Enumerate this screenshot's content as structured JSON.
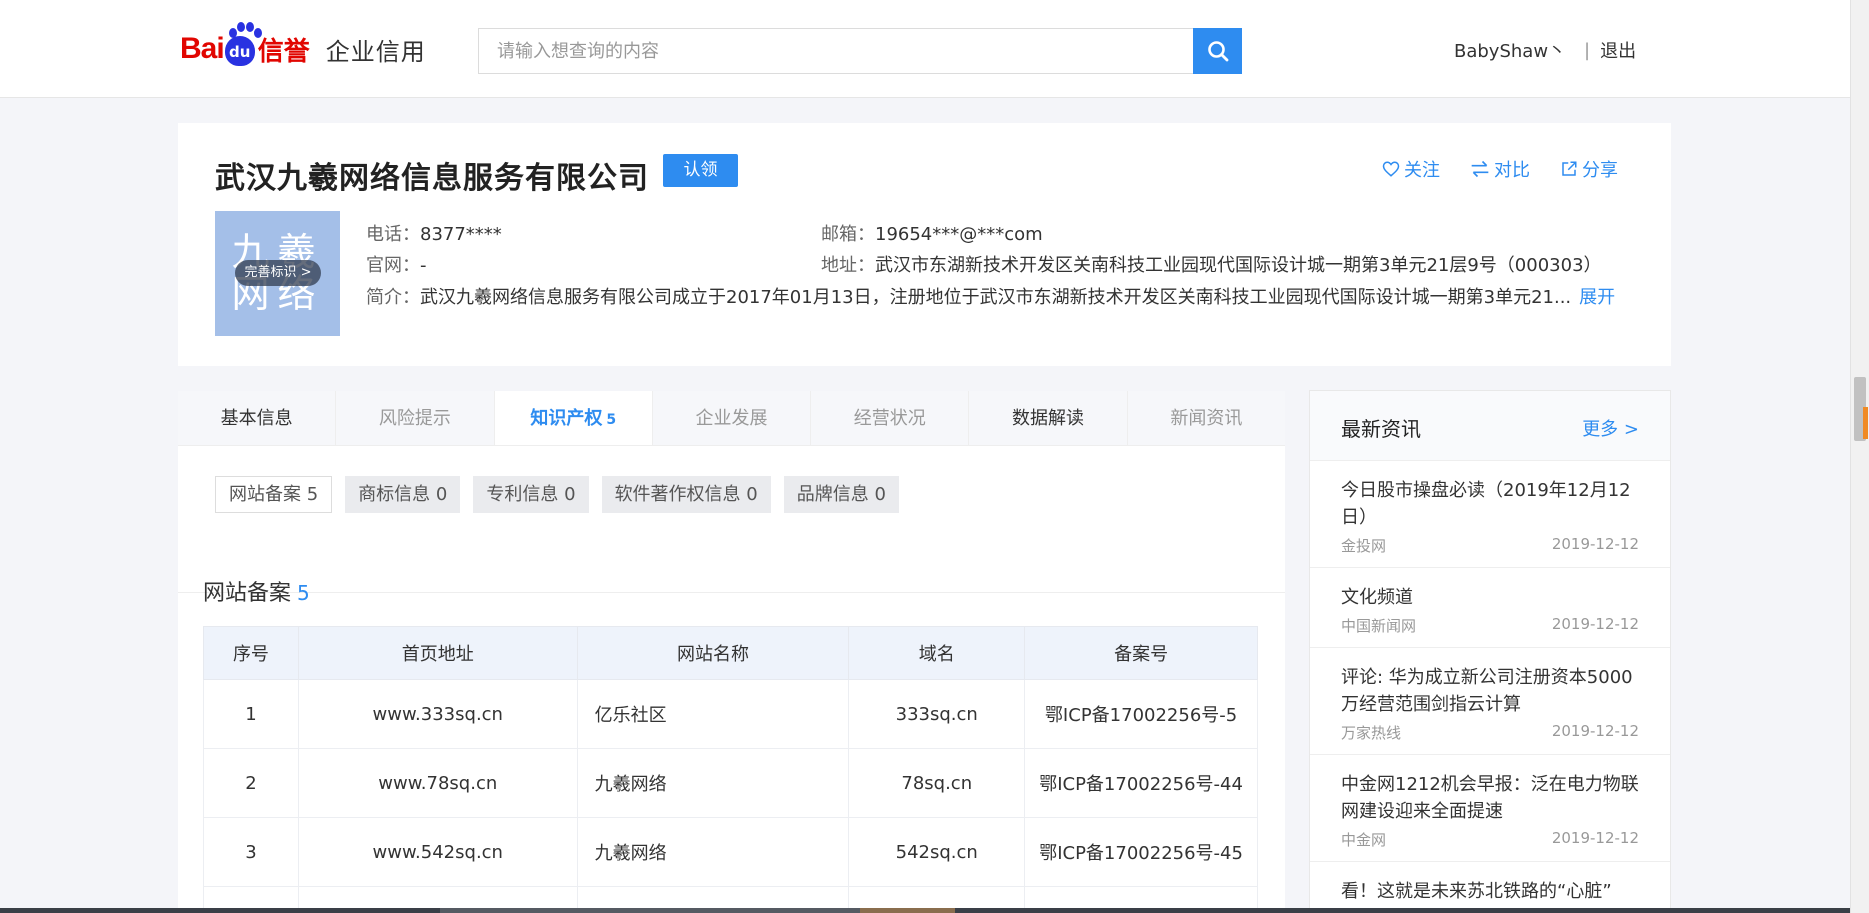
{
  "header": {
    "logo": {
      "bai": "Bai",
      "du": "du",
      "xinyu": "信誉",
      "product": "企业信用"
    },
    "search_placeholder": "请输入想查询的内容",
    "username": "BabyShaw丶",
    "separator": "|",
    "logout": "退出"
  },
  "company": {
    "name": "武汉九羲网络信息服务有限公司",
    "claim_label": "认领",
    "actions": {
      "follow": "关注",
      "compare": "对比",
      "share": "分享"
    },
    "logo_text": "九羲网络",
    "logo_badge": "完善标识 >",
    "phone_label": "电话：",
    "phone": "8377****",
    "website_label": "官网：",
    "website": "-",
    "intro_label": "简介：",
    "intro": "武汉九羲网络信息服务有限公司成立于2017年01月13日，注册地位于武汉市东湖新技术开发区关南科技工业园现代国际设计城一期第3单元21...",
    "expand_label": "展开",
    "email_label": "邮箱：",
    "email": "19654***@***com",
    "address_label": "地址：",
    "address": "武汉市东湖新技术开发区关南科技工业园现代国际设计城一期第3单元21层9号（000303）"
  },
  "tabs": [
    {
      "label": "基本信息"
    },
    {
      "label": "风险提示"
    },
    {
      "label": "知识产权",
      "count": "5"
    },
    {
      "label": "企业发展"
    },
    {
      "label": "经营状况"
    },
    {
      "label": "数据解读"
    },
    {
      "label": "新闻资讯"
    }
  ],
  "subtabs": [
    "网站备案 5",
    "商标信息 0",
    "专利信息 0",
    "软件著作权信息 0",
    "品牌信息 0"
  ],
  "section": {
    "title": "网站备案",
    "count": "5"
  },
  "table": {
    "headers": [
      "序号",
      "首页地址",
      "网站名称",
      "域名",
      "备案号"
    ],
    "rows": [
      [
        "1",
        "www.333sq.cn",
        "亿乐社区",
        "333sq.cn",
        "鄂ICP备17002256号-5"
      ],
      [
        "2",
        "www.78sq.cn",
        "九羲网络",
        "78sq.cn",
        "鄂ICP备17002256号-44"
      ],
      [
        "3",
        "www.542sq.cn",
        "九羲网络",
        "542sq.cn",
        "鄂ICP备17002256号-45"
      ]
    ]
  },
  "news": {
    "title": "最新资讯",
    "more": "更多 >",
    "items": [
      {
        "title": "今日股市操盘必读（2019年12月12日）",
        "source": "金投网",
        "date": "2019-12-12"
      },
      {
        "title": "文化频道",
        "source": "中国新闻网",
        "date": "2019-12-12"
      },
      {
        "title": "评论: 华为成立新公司注册资本5000万经营范围剑指云计算",
        "source": "万家热线",
        "date": "2019-12-12"
      },
      {
        "title": "中金网1212机会早报：泛在电力物联网建设迎来全面提速",
        "source": "中金网",
        "date": "2019-12-12"
      },
      {
        "title": "看！这就是未来苏北铁路的“心脏”",
        "source": "",
        "date": ""
      }
    ]
  },
  "colors": {
    "accent": "#2e8cf0",
    "baidu_red": "#e10601",
    "baidu_blue": "#2932e1",
    "logo_bg": "#a4bfe8"
  }
}
